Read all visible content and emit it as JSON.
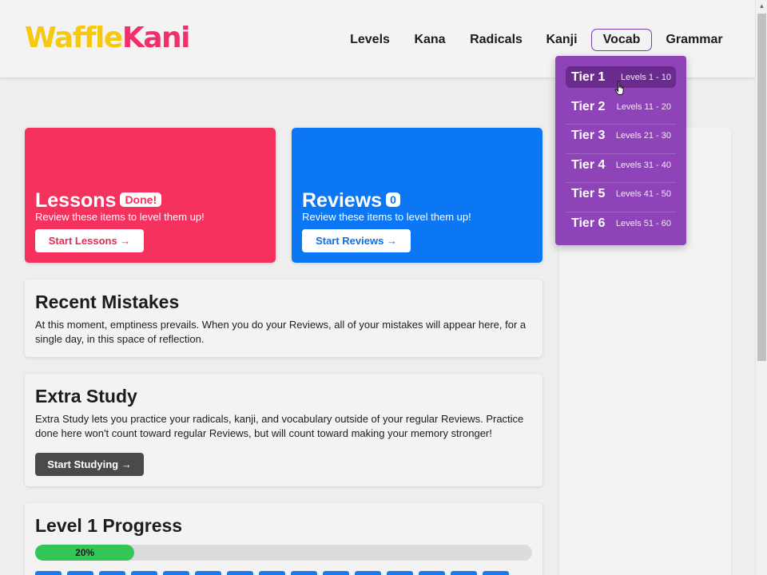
{
  "brand": {
    "part1": "Waffle",
    "part2": "Kani",
    "color1": "#f6c90e",
    "color2": "#f0306a"
  },
  "nav": [
    {
      "label": "Levels"
    },
    {
      "label": "Kana"
    },
    {
      "label": "Radicals"
    },
    {
      "label": "Kanji"
    },
    {
      "label": "Vocab",
      "active": true
    },
    {
      "label": "Grammar"
    }
  ],
  "dropdown": {
    "tiers": [
      {
        "name": "Tier 1",
        "range": "Levels 1 - 10",
        "hovered": true
      },
      {
        "name": "Tier 2",
        "range": "Levels 11 - 20"
      },
      {
        "name": "Tier 3",
        "range": "Levels 21 - 30"
      },
      {
        "name": "Tier 4",
        "range": "Levels 31 - 40"
      },
      {
        "name": "Tier 5",
        "range": "Levels 41 - 50"
      },
      {
        "name": "Tier 6",
        "range": "Levels 51 - 60"
      }
    ]
  },
  "lessons": {
    "title": "Lessons",
    "badge": "Done!",
    "subtitle": "Review these items to level them up!",
    "button": "Start Lessons →",
    "color": "#f5315e"
  },
  "reviews": {
    "title": "Reviews",
    "badge": "0",
    "subtitle": "Review these items to level them up!",
    "button": "Start Reviews →",
    "color": "#0b77f4"
  },
  "mistakes": {
    "title": "Recent Mistakes",
    "text": "At this moment, emptiness prevails. When you do your Reviews, all of your mistakes will appear here, for a single day, in this space of reflection."
  },
  "extra_study": {
    "title": "Extra Study",
    "text": "Extra Study lets you practice your radicals, kanji, and vocabulary outside of your regular Reviews. Practice done here won't count toward regular Reviews, but will count toward making your memory stronger!",
    "button": "Start Studying →"
  },
  "level_progress": {
    "title": "Level 1 Progress",
    "percent_label": "20%",
    "fraction": 0.2,
    "item_count_visible": 15,
    "bar_color": "#33c654",
    "item_color": "#1a7af0"
  }
}
